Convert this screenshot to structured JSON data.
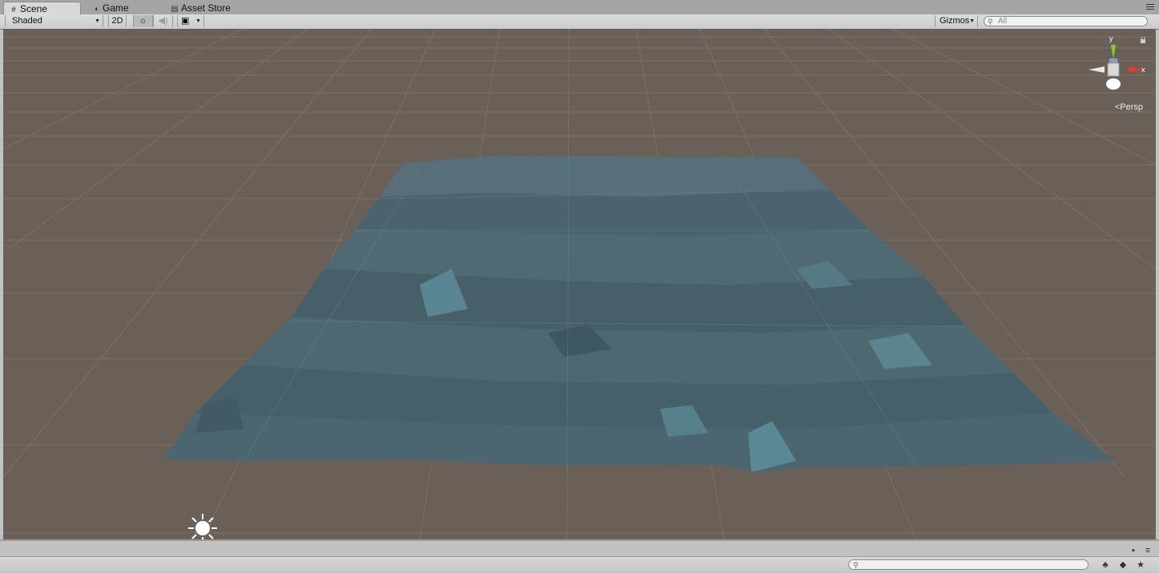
{
  "tabs": [
    {
      "label": "Scene",
      "icon": "grid-icon",
      "active": true
    },
    {
      "label": "Game",
      "icon": "pacman-icon",
      "active": false
    },
    {
      "label": "Asset Store",
      "icon": "bag-icon",
      "active": false
    }
  ],
  "toolbar": {
    "draw_mode": "Shaded",
    "mode_2d": "2D",
    "gizmos": "Gizmos",
    "search_placeholder": "All"
  },
  "scene": {
    "projection": "Persp",
    "axes": {
      "y": "y",
      "x": "x"
    },
    "background_color": "#6a6058",
    "mesh_color": "#4a6470"
  },
  "colors": {
    "axis_y": "#7fcf2f",
    "axis_x": "#e03a2a",
    "toolbar_bg": "#d4d4d4"
  }
}
